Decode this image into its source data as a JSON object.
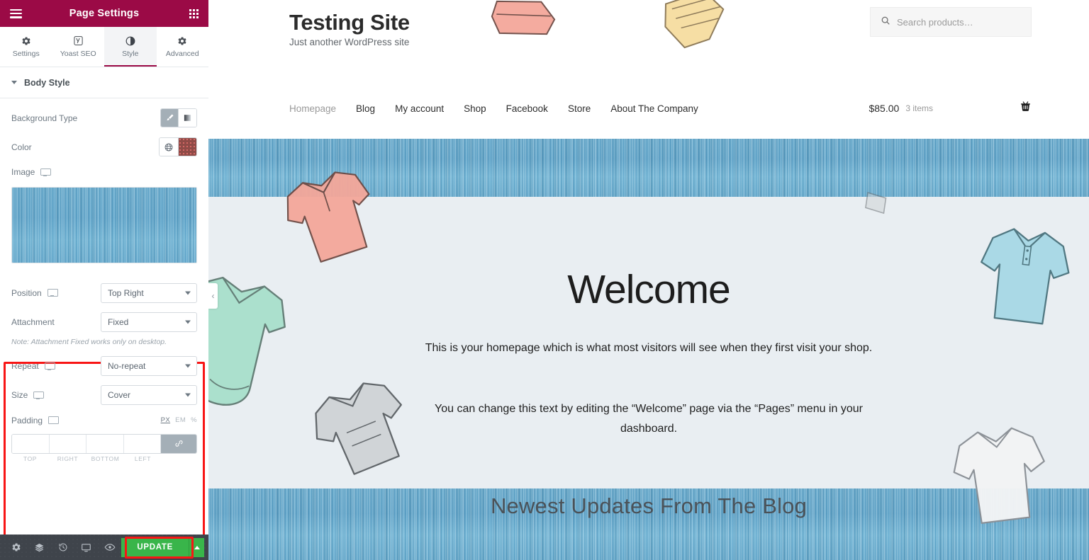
{
  "panel": {
    "header": {
      "title": "Page Settings",
      "menu_icon": "hamburger-icon",
      "apps_icon": "grid-apps-icon"
    },
    "tabs": [
      {
        "label": "Settings",
        "icon": "gear-icon",
        "active": false
      },
      {
        "label": "Yoast SEO",
        "icon": "yoast-logo-icon",
        "active": false
      },
      {
        "label": "Style",
        "icon": "contrast-half-circle-icon",
        "active": true
      },
      {
        "label": "Advanced",
        "icon": "gear-icon",
        "active": false
      }
    ],
    "section": {
      "title": "Body Style",
      "collapsed": false
    },
    "controls": {
      "background_type": {
        "label": "Background Type",
        "options": [
          {
            "name": "classic",
            "icon": "paint-brush-icon",
            "selected": true
          },
          {
            "name": "gradient",
            "icon": "gradient-icon",
            "selected": false
          }
        ]
      },
      "color": {
        "label": "Color",
        "global_icon": "globe-icon",
        "swatch_hex": "#8f4b47"
      },
      "image": {
        "label": "Image",
        "responsive_icon": "monitor-icon"
      },
      "position": {
        "label": "Position",
        "responsive_icon": "monitor-icon",
        "value": "Top Right"
      },
      "attachment": {
        "label": "Attachment",
        "value": "Fixed"
      },
      "attachment_note": "Note: Attachment Fixed works only on desktop.",
      "repeat": {
        "label": "Repeat",
        "responsive_icon": "monitor-icon",
        "value": "No-repeat"
      },
      "size": {
        "label": "Size",
        "responsive_icon": "monitor-icon",
        "value": "Cover"
      },
      "padding": {
        "label": "Padding",
        "responsive_icon": "monitor-icon",
        "units": [
          {
            "label": "PX",
            "selected": true
          },
          {
            "label": "EM",
            "selected": false
          },
          {
            "label": "%",
            "selected": false
          }
        ],
        "fields": [
          {
            "side": "TOP",
            "value": ""
          },
          {
            "side": "RIGHT",
            "value": ""
          },
          {
            "side": "BOTTOM",
            "value": ""
          },
          {
            "side": "LEFT",
            "value": ""
          }
        ],
        "link_icon": "link-chain-icon"
      }
    },
    "footer": {
      "icons": [
        {
          "name": "gear-icon",
          "title": "Settings"
        },
        {
          "name": "layers-icon",
          "title": "Navigator"
        },
        {
          "name": "history-icon",
          "title": "History"
        },
        {
          "name": "monitor-icon",
          "title": "Responsive Mode"
        },
        {
          "name": "eye-icon",
          "title": "Preview Changes"
        }
      ],
      "update_label": "UPDATE",
      "update_color": "#39b54a",
      "caret_icon": "caret-up-icon"
    },
    "highlight_color": "#f81515"
  },
  "preview": {
    "collapse_icon": "chevron-left-icon",
    "site": {
      "title": "Testing Site",
      "tagline": "Just another WordPress site",
      "search": {
        "placeholder": "Search products…",
        "icon": "search-icon"
      },
      "nav": [
        {
          "label": "Homepage",
          "current": true
        },
        {
          "label": "Blog",
          "current": false
        },
        {
          "label": "My account",
          "current": false
        },
        {
          "label": "Shop",
          "current": false
        },
        {
          "label": "Facebook",
          "current": false
        },
        {
          "label": "Store",
          "current": false
        },
        {
          "label": "About The Company",
          "current": false
        }
      ],
      "cart": {
        "amount": "$85.00",
        "count": "3 items",
        "icon": "shopping-basket-icon"
      }
    },
    "hero": {
      "heading": "Welcome",
      "paragraph_1": "This is your homepage which is what most visitors will see when they first visit your shop.",
      "paragraph_2": "You can change this text by editing the “Welcome” page via the “Pages” menu in your dashboard.",
      "background_hex": "#e9eef2"
    },
    "blog_section": {
      "heading": "Newest Updates From The Blog"
    },
    "background_image": "denim-texture",
    "denim_hex": "#5ea8cd"
  }
}
